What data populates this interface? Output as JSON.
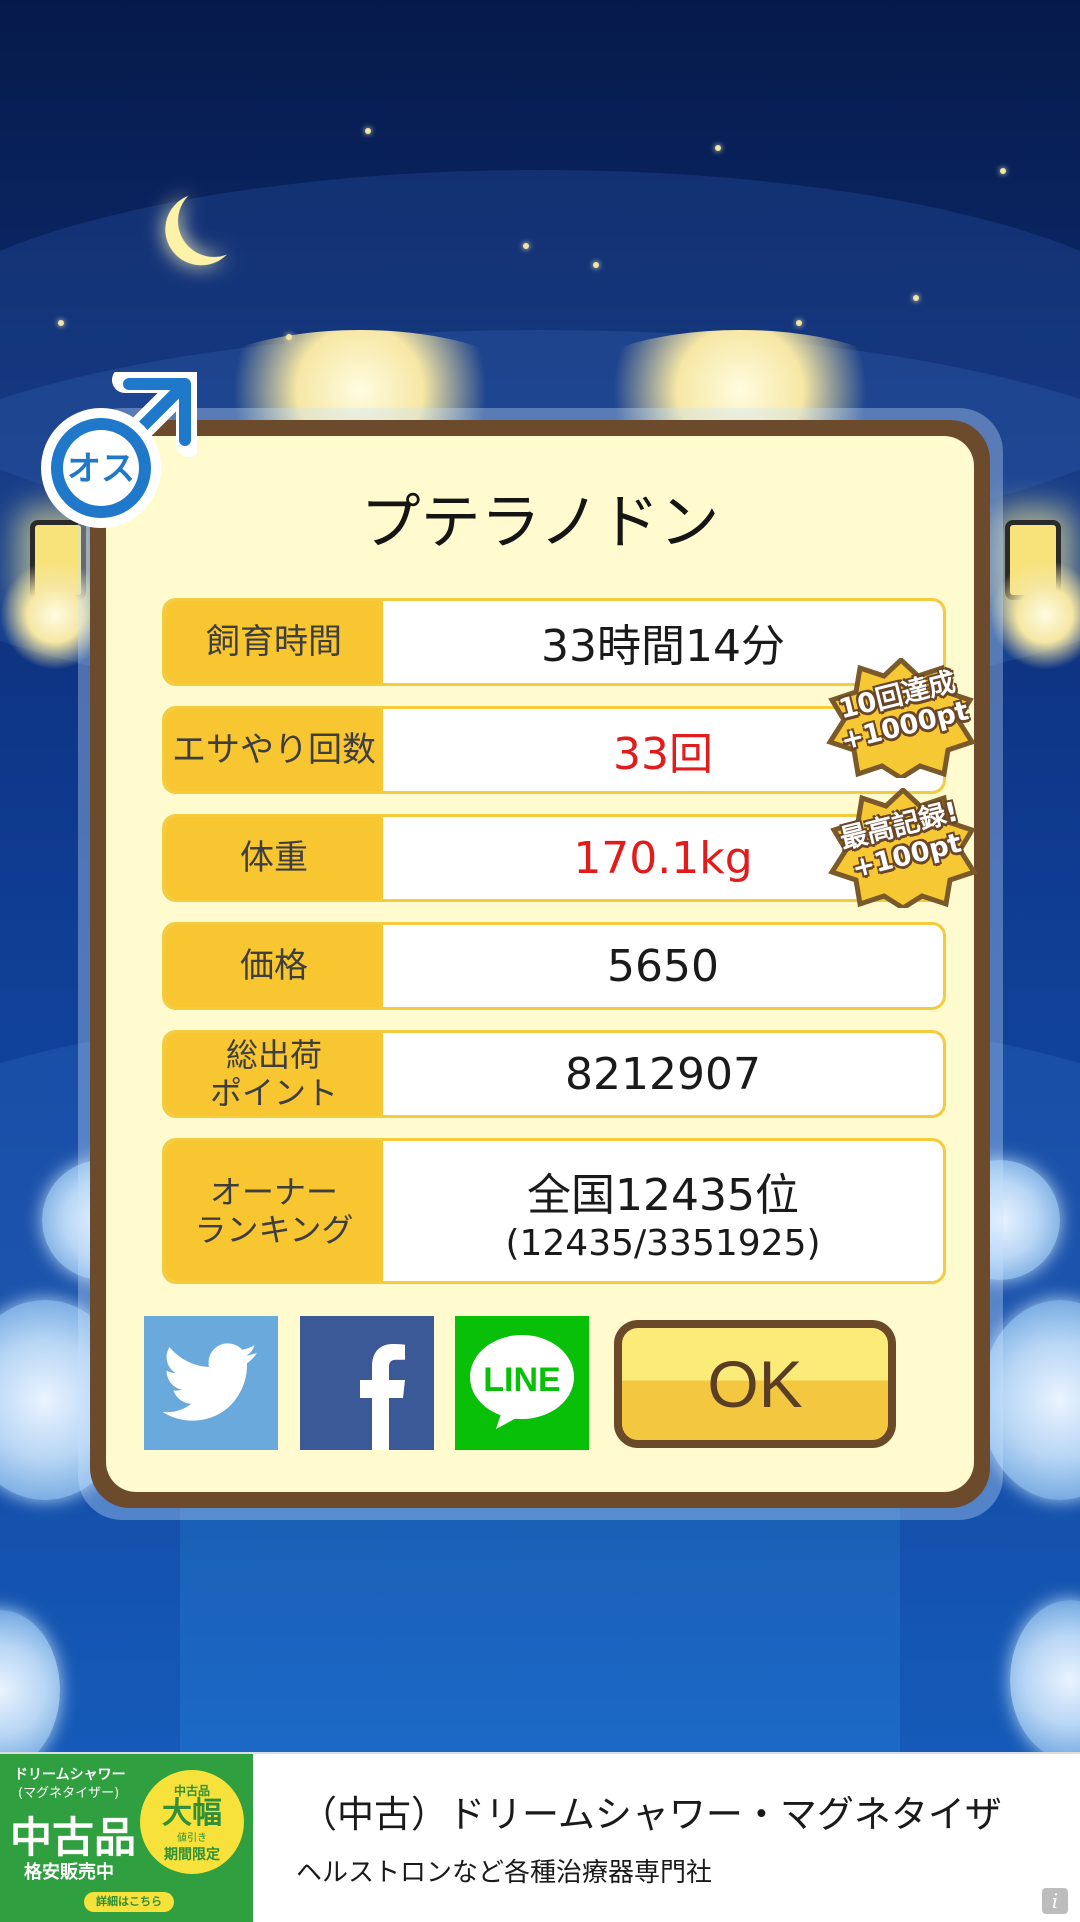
{
  "dialog": {
    "title": "プテラノドン",
    "rows": [
      {
        "label": "飼育時間",
        "value": "33時間14分"
      },
      {
        "label": "エサやり回数",
        "value": "33回",
        "highlight": true
      },
      {
        "label": "体重",
        "value": "170.1kg",
        "highlight": true
      },
      {
        "label": "価格",
        "value": "5650"
      },
      {
        "label_line1": "総出荷",
        "label_line2": "ポイント",
        "value": "8212907"
      },
      {
        "label_line1": "オーナー",
        "label_line2": "ランキング",
        "value_line1": "全国12435位",
        "value_line2": "(12435/3351925)"
      }
    ],
    "ok_label": "OK",
    "gender_badge": "オス",
    "bonus_badges": [
      {
        "line1": "10回達成",
        "line2": "+1000pt"
      },
      {
        "line1": "最高記録!",
        "line2": "+100pt"
      }
    ],
    "share": {
      "line_label": "LINE"
    }
  },
  "icons": [
    "male-symbol-icon",
    "twitter-bird-icon",
    "facebook-icon",
    "line-icon",
    "info-icon",
    "moon-icon"
  ],
  "colors": {
    "panel_bg": "#fffbcf",
    "panel_border": "#6c4a2c",
    "label_bg": "#f8c630",
    "highlight_text": "#e21c1c",
    "ok_button": "#f3c740"
  },
  "ad": {
    "title": "（中古）ドリームシャワー・マグネタイザ",
    "description": "ヘルストロンなど各種治療器専門社",
    "image_text": {
      "line1": "ドリームシャワー",
      "line2": "(マグネタイザー)",
      "big": "中古品",
      "sub": "格安販売中",
      "badge_top": "中古品",
      "badge_big": "大幅",
      "badge_side": "値引き",
      "badge_bottom": "期間限定",
      "link": "詳細はこちら"
    },
    "info_icon": "i"
  }
}
